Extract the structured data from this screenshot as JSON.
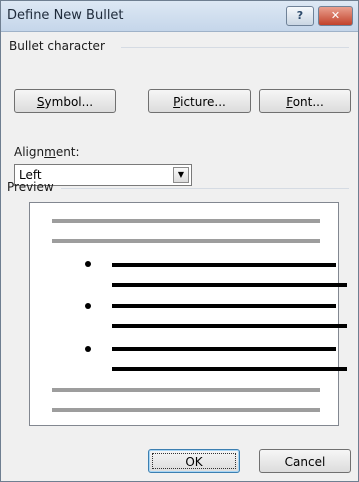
{
  "dialog": {
    "title": "Define New Bullet",
    "help_glyph": "?",
    "close_glyph": "✕"
  },
  "bullet_character": {
    "group_label": "Bullet character",
    "symbol_label_pre": "",
    "symbol_label_key": "S",
    "symbol_label_post": "ymbol...",
    "picture_label_key": "P",
    "picture_label_post": "icture...",
    "font_label_key": "F",
    "font_label_post": "ont..."
  },
  "alignment": {
    "label_pre": "Align",
    "label_key": "m",
    "label_post": "ent:",
    "selected": "Left",
    "dropdown_arrow": "▼"
  },
  "preview": {
    "group_label": "Preview"
  },
  "footer": {
    "ok_label": "OK",
    "cancel_label": "Cancel"
  },
  "colors": {
    "title_bar": "#c5d6ea",
    "close_button": "#c2422b",
    "preview_rule": "#9d9d9d"
  }
}
